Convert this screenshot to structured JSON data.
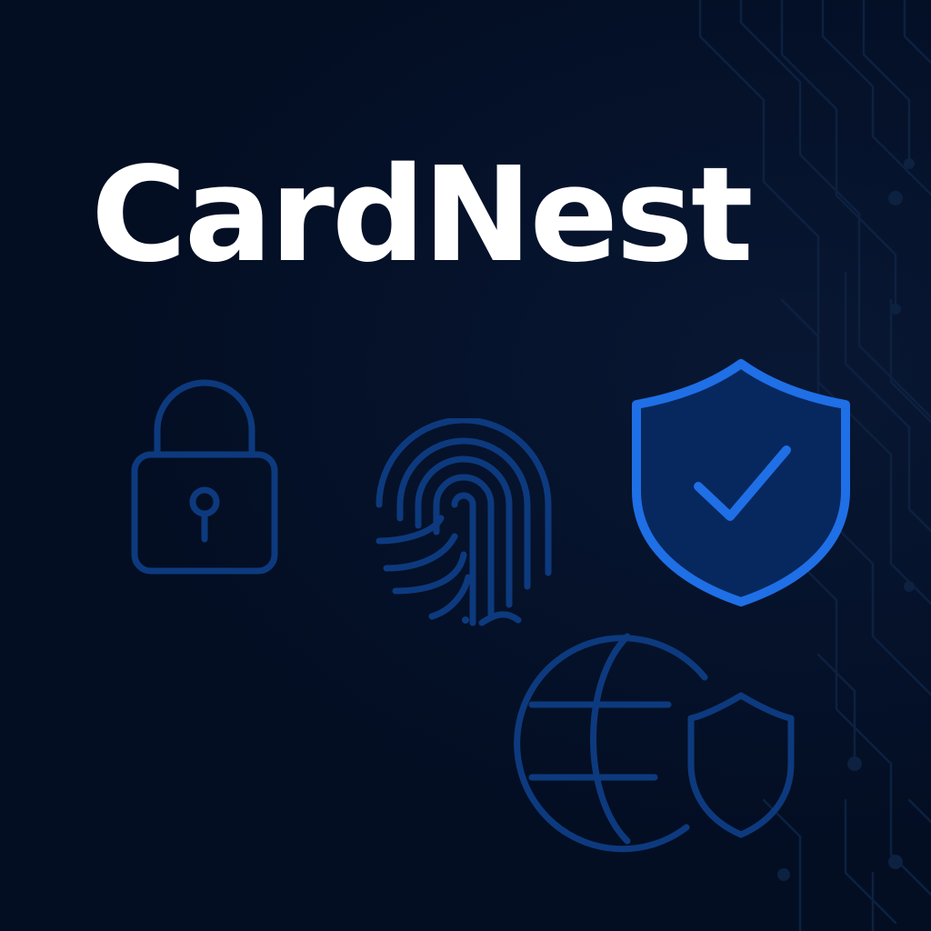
{
  "brand": {
    "title": "CardNest"
  },
  "icons": {
    "lock": "lock-icon",
    "fingerprint": "fingerprint-icon",
    "shield": "shield-check-icon",
    "globe": "globe-shield-icon"
  },
  "colors": {
    "background": "#030e23",
    "title": "#ffffff",
    "icon_dim": "#0d3a7e",
    "shield_stroke": "#1f6fe6",
    "shield_fill": "#07285f",
    "circuit": "#0d2140"
  }
}
